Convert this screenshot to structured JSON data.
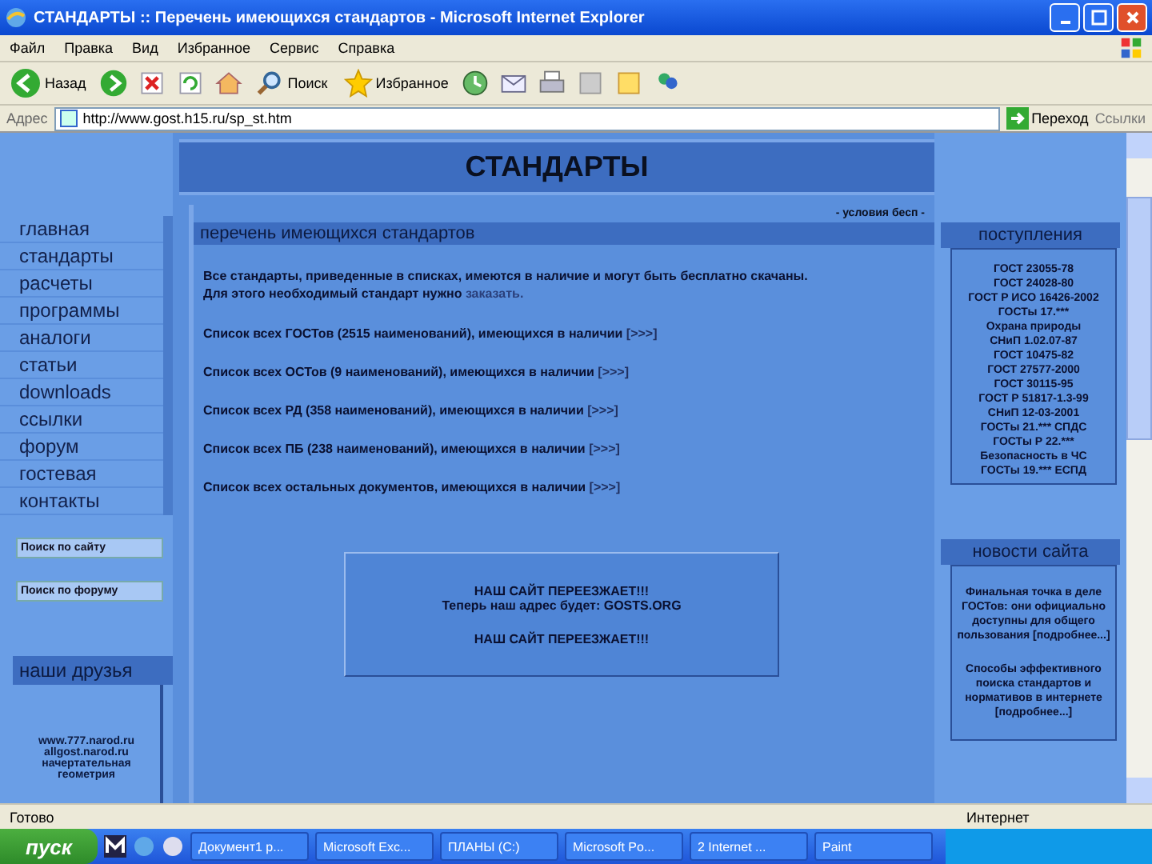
{
  "window": {
    "title": "СТАНДАРТЫ :: Перечень имеющихся стандартов - Microsoft Internet Explorer"
  },
  "menu": [
    "Файл",
    "Правка",
    "Вид",
    "Избранное",
    "Сервис",
    "Справка"
  ],
  "toolbar": {
    "back": "Назад",
    "search": "Поиск",
    "favorites": "Избранное"
  },
  "address": {
    "label": "Адрес",
    "url": "http://www.gost.h15.ru/sp_st.htm",
    "go": "Переход",
    "links": "Ссылки"
  },
  "page": {
    "banner": "СТАНДАРТЫ",
    "nav": [
      "главная",
      "стандарты",
      "расчеты",
      "программы",
      "аналоги",
      "статьи",
      "downloads",
      "ссылки",
      "форум",
      "гостевая",
      "контакты"
    ],
    "search_fields": [
      {
        "placeholder": "Поиск по сайту"
      },
      {
        "placeholder": "Поиск по форуму"
      }
    ],
    "friends": {
      "title": "наши друзья",
      "links": [
        "www.777.narod.ru",
        "allgost.narod.ru",
        "начертательная геометрия"
      ]
    },
    "terms_link": "- условия бесп -",
    "section_title": "перечень имеющихся стандартов",
    "intro": "Все стандарты, приведенные в списках, имеются в наличие и могут быть бесплатно скачаны.",
    "intro2": {
      "text": "Для этого необходимый стандарт нужно",
      "link": "заказать."
    },
    "lists": [
      {
        "text": "Список всех ГОСТов (2515 наименований), имеющихся в наличии",
        "link": "[>>>]"
      },
      {
        "text": "Список всех ОСТов (9 наименований), имеющихся в наличии",
        "link": "[>>>]"
      },
      {
        "text": "Список всех РД (358 наименований), имеющихся в наличии",
        "link": "[>>>]"
      },
      {
        "text": "Список всех ПБ (238 наименований), имеющихся в наличии",
        "link": "[>>>]"
      },
      {
        "text": "Список всех остальных документов, имеющихся в наличии",
        "link": "[>>>]"
      }
    ],
    "notice": [
      "НАШ САЙТ ПЕРЕЕЗЖАЕТ!!!",
      "Теперь наш адрес будет: GOSTS.ORG",
      "НАШ САЙТ ПЕРЕЕЗЖАЕТ!!!"
    ],
    "arrivals": {
      "title": "поступления",
      "items": [
        "ГОСТ 23055-78",
        "ГОСТ 24028-80",
        "ГОСТ Р ИСО 16426-2002",
        "ГОСТы 17.***",
        "Охрана природы",
        "СНиП 1.02.07-87",
        "ГОСТ 10475-82",
        "ГОСТ 27577-2000",
        "ГОСТ 30115-95",
        "ГОСТ Р 51817-1.3-99",
        "СНиП 12-03-2001",
        "ГОСТы 21.*** СПДС",
        "ГОСТы Р 22.***",
        "Безопасность в ЧС",
        "ГОСТы 19.*** ЕСПД"
      ]
    },
    "news": {
      "title": "новости сайта",
      "items": [
        {
          "text": "Финальная точка в деле ГОСТов: они официально доступны для общего пользования",
          "more": "[подробнее...]"
        },
        {
          "text": "Способы эффективного поиска стандартов и нормативов в интернете",
          "more": "[подробнее...]"
        }
      ]
    }
  },
  "status_bar": {
    "text": "Готово",
    "zone": "Интернет"
  },
  "taskbar": {
    "start": "пуск",
    "tasks": [
      "Документ1 р...",
      "Microsoft Exc...",
      "ПЛАНЫ (C:)",
      "Microsoft Po...",
      "2 Internet ...",
      "Paint"
    ]
  }
}
